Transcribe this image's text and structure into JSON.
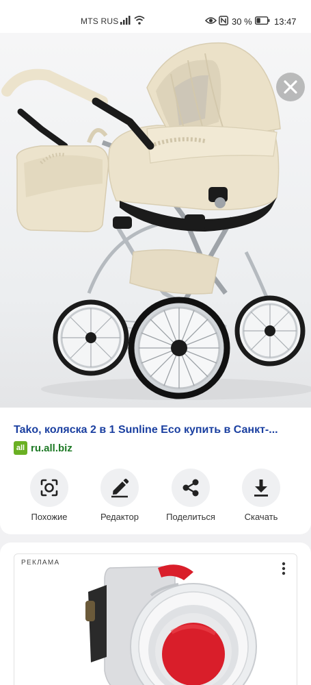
{
  "status_bar": {
    "carrier": "MTS RUS",
    "battery_percent": "30 %",
    "time": "13:47",
    "icons": [
      "signal-icon",
      "wifi-icon",
      "eye-icon",
      "nfc-icon",
      "battery-icon"
    ]
  },
  "result": {
    "title": "Tako, коляска 2 в 1 Sunline Eco купить в Санкт-...",
    "favicon": "all",
    "source": "ru.all.biz"
  },
  "actions": [
    {
      "label": "Похожие",
      "icon": "lens-icon"
    },
    {
      "label": "Редактор",
      "icon": "pencil-icon"
    },
    {
      "label": "Поделиться",
      "icon": "share-icon"
    },
    {
      "label": "Скачать",
      "icon": "download-icon"
    }
  ],
  "ad": {
    "label": "РЕКЛАМА"
  },
  "colors": {
    "title_link": "#1a3fa0",
    "source_green": "#1e7a26",
    "favicon_green": "#6ab023",
    "stroller_beige": "#ece3cc",
    "socket_red": "#d91e2a"
  }
}
